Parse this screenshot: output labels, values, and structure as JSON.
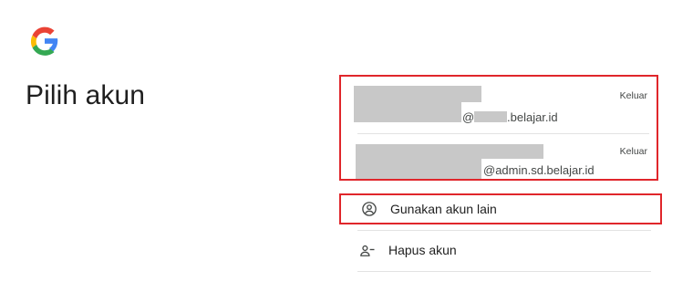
{
  "page": {
    "title": "Pilih akun"
  },
  "logo": {
    "icon": "google-g-icon",
    "colors": {
      "blue": "#4285F4",
      "red": "#EA4335",
      "yellow": "#FBBC05",
      "green": "#34A853"
    }
  },
  "accounts": [
    {
      "email_visible_part_1": "@",
      "email_visible_part_2": ".belajar.id",
      "signout_label": "Keluar"
    },
    {
      "email_visible_part": "@admin.sd.belajar.id",
      "signout_label": "Keluar"
    }
  ],
  "actions": {
    "use_other": {
      "label": "Gunakan akun lain",
      "icon": "account-circle-icon"
    },
    "remove": {
      "label": "Hapus akun",
      "icon": "person-remove-icon"
    }
  },
  "highlight_color": "#e0262b",
  "redaction_color": "#c8c8c8"
}
